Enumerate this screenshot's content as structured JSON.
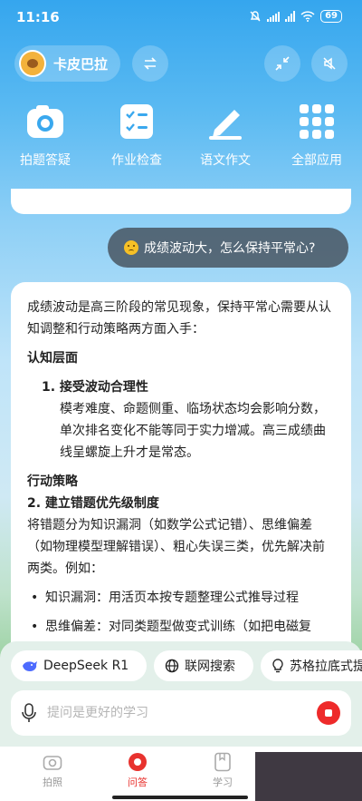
{
  "status_bar": {
    "time": "11:16",
    "battery": "69"
  },
  "header": {
    "username": "卡皮巴拉"
  },
  "apps": [
    {
      "label": "拍题答疑",
      "icon": "camera-icon"
    },
    {
      "label": "作业检查",
      "icon": "checklist-icon"
    },
    {
      "label": "语文作文",
      "icon": "pen-icon"
    },
    {
      "label": "全部应用",
      "icon": "grid-icon"
    }
  ],
  "chat": {
    "question": "成绩波动大，怎么保持平常心?",
    "answer": {
      "intro": "成绩波动是高三阶段的常见现象，保持平常心需要从认知调整和行动策略两方面入手：",
      "section1_title": "认知层面",
      "item1_title": "1. 接受波动合理性",
      "item1_body": "模考难度、命题侧重、临场状态均会影响分数，单次排名变化不能等同于实力增减。高三成绩曲线呈螺旋上升才是常态。",
      "section2_title": "行动策略",
      "item2_title": "2. 建立错题优先级制度",
      "item2_body": "将错题分为知识漏洞（如数学公式记错）、思维偏差（如物理模型理解错误）、粗心失误三类，优先解决前两类。例如：",
      "bullets": [
        "知识漏洞：用活页本按专题整理公式推导过程",
        "思维偏差：对同类题型做变式训练（如把电磁复"
      ]
    }
  },
  "chips": [
    {
      "label": "DeepSeek R1",
      "icon": "deepseek-whale-icon"
    },
    {
      "label": "联网搜索",
      "icon": "globe-icon"
    },
    {
      "label": "苏格拉底式提问",
      "icon": "bulb-icon"
    }
  ],
  "input": {
    "placeholder": "提问是更好的学习"
  },
  "nav": [
    {
      "label": "拍照"
    },
    {
      "label": "问答"
    },
    {
      "label": "学习"
    }
  ],
  "colors": {
    "accent_red": "#e8322e",
    "sky_blue": "#35a6ee"
  }
}
